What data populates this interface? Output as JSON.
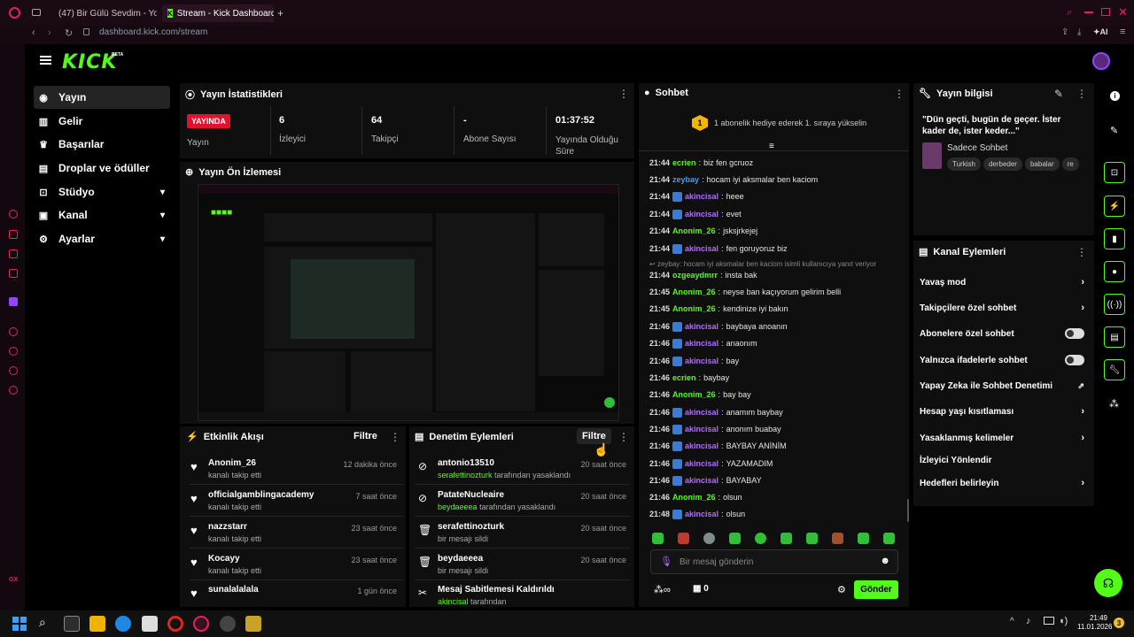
{
  "browser": {
    "tabs": [
      "(47) Bir Gülü Sevdim - You",
      "Stream - Kick Dashboard"
    ],
    "url": "dashboard.kick.com/stream",
    "ai_label": "AI"
  },
  "kick": {
    "logo": "KICK",
    "beta": "BETA",
    "nav": [
      {
        "label": "Yayın",
        "icon": "broadcast-icon"
      },
      {
        "label": "Gelir",
        "icon": "chart-icon"
      },
      {
        "label": "Başarılar",
        "icon": "trophy-icon"
      },
      {
        "label": "Droplar ve ödüller",
        "icon": "gift-icon"
      },
      {
        "label": "Stüdyo",
        "icon": "studio-icon"
      },
      {
        "label": "Kanal",
        "icon": "channel-icon"
      },
      {
        "label": "Ayarlar",
        "icon": "settings-icon"
      }
    ]
  },
  "stats": {
    "title": "Yayın İstatistikleri",
    "live_badge": "YAYINDA",
    "live_label": "Yayın",
    "viewers_value": "6",
    "viewers_label": "İzleyici",
    "followers_value": "64",
    "followers_label": "Takipçi",
    "subs_value": "-",
    "subs_label": "Abone Sayısı",
    "duration_value": "01:37:52",
    "duration_label": "Yayında Olduğu Süre"
  },
  "preview": {
    "title": "Yayın Ön İzlemesi"
  },
  "activity": {
    "title": "Etkinlik Akışı",
    "filter": "Filtre",
    "items": [
      {
        "name": "Anonim_26",
        "sub": "kanalı takip etti",
        "time": "12 dakika önce"
      },
      {
        "name": "officialgamblingacademy",
        "sub": "kanalı takip etti",
        "time": "7 saat önce"
      },
      {
        "name": "nazzstarr",
        "sub": "kanalı takip etti",
        "time": "23 saat önce"
      },
      {
        "name": "Kocayy",
        "sub": "kanalı takip etti",
        "time": "23 saat önce"
      },
      {
        "name": "sunalalalala",
        "sub": "kanalı takip etti",
        "time": "1 gün önce"
      }
    ]
  },
  "moderation": {
    "title": "Denetim Eylemleri",
    "filter": "Filtre",
    "items": [
      {
        "name": "antonio13510",
        "by": "serafettinozturk",
        "sub": "tarafından yasaklandı",
        "time": "20 saat önce"
      },
      {
        "name": "PatateNucleaire",
        "by": "beydaeeea",
        "sub": "tarafından yasaklandı",
        "time": "20 saat önce"
      },
      {
        "name": "serafettinozturk",
        "by": "",
        "sub": "bir mesajı sildi",
        "time": "20 saat önce"
      },
      {
        "name": "beydaeeea",
        "by": "",
        "sub": "bir mesajı sildi",
        "time": "20 saat önce"
      },
      {
        "name": "Mesaj Sabitlemesi Kaldırıldı",
        "by": "akincisal",
        "sub": "tarafından",
        "time": ""
      }
    ]
  },
  "chat": {
    "title": "Sohbet",
    "gift_banner": "1 abonelik hediye ederek 1. sıraya yükselin",
    "gift_rank": "1",
    "reply_note": "zeybay: hocam iyi aksmalar ben kaciom isimli kullanıcıya yanıt veriyor",
    "messages": [
      {
        "time": "21:44",
        "user": "ecrien",
        "color": "#53fc18",
        "badge": false,
        "text": "biz fen gcruoz"
      },
      {
        "time": "21:44",
        "user": "zeybay",
        "color": "#3aa0ff",
        "badge": false,
        "text": "hocam iyi aksmalar ben kaciom"
      },
      {
        "time": "21:44",
        "user": "akincisal",
        "color": "#b36bff",
        "badge": true,
        "text": "heee"
      },
      {
        "time": "21:44",
        "user": "akincisal",
        "color": "#b36bff",
        "badge": true,
        "text": "evet"
      },
      {
        "time": "21:44",
        "user": "Anonim_26",
        "color": "#53fc18",
        "badge": false,
        "text": "jsksjrkejej"
      },
      {
        "time": "21:44",
        "user": "akincisal",
        "color": "#b36bff",
        "badge": true,
        "text": "fen goruyoruz biz"
      },
      {
        "time": "21:44",
        "user": "ozgeaydmrr",
        "color": "#53fc18",
        "badge": false,
        "text": "insta bak"
      },
      {
        "time": "21:45",
        "user": "Anonim_26",
        "color": "#53fc18",
        "badge": false,
        "text": "neyse ban kaçıyorum gelirim belli"
      },
      {
        "time": "21:45",
        "user": "Anonim_26",
        "color": "#53fc18",
        "badge": false,
        "text": "kendinize iyi bakın"
      },
      {
        "time": "21:46",
        "user": "akincisal",
        "color": "#b36bff",
        "badge": true,
        "text": "baybaya anoanın"
      },
      {
        "time": "21:46",
        "user": "akincisal",
        "color": "#b36bff",
        "badge": true,
        "text": "anaonım"
      },
      {
        "time": "21:46",
        "user": "akincisal",
        "color": "#b36bff",
        "badge": true,
        "text": "bay"
      },
      {
        "time": "21:46",
        "user": "ecrien",
        "color": "#53fc18",
        "badge": false,
        "text": "baybay"
      },
      {
        "time": "21:46",
        "user": "Anonim_26",
        "color": "#53fc18",
        "badge": false,
        "text": "bay bay"
      },
      {
        "time": "21:46",
        "user": "akincisal",
        "color": "#b36bff",
        "badge": true,
        "text": "anamım baybay"
      },
      {
        "time": "21:46",
        "user": "akincisal",
        "color": "#b36bff",
        "badge": true,
        "text": "anonım buabay"
      },
      {
        "time": "21:46",
        "user": "akincisal",
        "color": "#b36bff",
        "badge": true,
        "text": "BAYBAY ANİNİM"
      },
      {
        "time": "21:46",
        "user": "akincisal",
        "color": "#b36bff",
        "badge": true,
        "text": "YAZAMADIM"
      },
      {
        "time": "21:46",
        "user": "akincisal",
        "color": "#b36bff",
        "badge": true,
        "text": "BAYABAY"
      },
      {
        "time": "21:46",
        "user": "Anonim_26",
        "color": "#53fc18",
        "badge": false,
        "text": "olsun"
      },
      {
        "time": "21:48",
        "user": "akincisal",
        "color": "#b36bff",
        "badge": true,
        "text": "olsun"
      }
    ],
    "placeholder": "Bir mesaj gönderin",
    "points": "0",
    "send": "Gönder"
  },
  "stream_info": {
    "title": "Yayın bilgisi",
    "stream_title": "\"Dün geçti, bugün de geçer. İster kader de, ister keder...\"",
    "category": "Sadece Sohbet",
    "tags": [
      "Turkish",
      "derbeder",
      "babalar",
      "re"
    ]
  },
  "channel_actions": {
    "title": "Kanal Eylemleri",
    "items": [
      {
        "label": "Yavaş mod",
        "control": "chevron"
      },
      {
        "label": "Takipçilere özel sohbet",
        "control": "chevron"
      },
      {
        "label": "Abonelere özel sohbet",
        "control": "toggle"
      },
      {
        "label": "Yalnızca ifadelerle sohbet",
        "control": "toggle"
      },
      {
        "label": "Yapay Zeka ile Sohbet Denetimi",
        "control": "external"
      },
      {
        "label": "Hesap yaşı kısıtlaması",
        "control": "chevron"
      },
      {
        "label": "Yasaklanmış kelimeler",
        "control": "chevron"
      },
      {
        "label": "İzleyici Yönlendir",
        "control": "none"
      },
      {
        "label": "Hedefleri belirleyin",
        "control": "chevron"
      }
    ]
  },
  "taskbar": {
    "time": "21:49",
    "date": "11.01.2026",
    "notif": "3"
  },
  "colors": {
    "accent": "#53fc18",
    "live": "#e4112e",
    "bg": "#000000",
    "panel": "#0f0f0f"
  }
}
